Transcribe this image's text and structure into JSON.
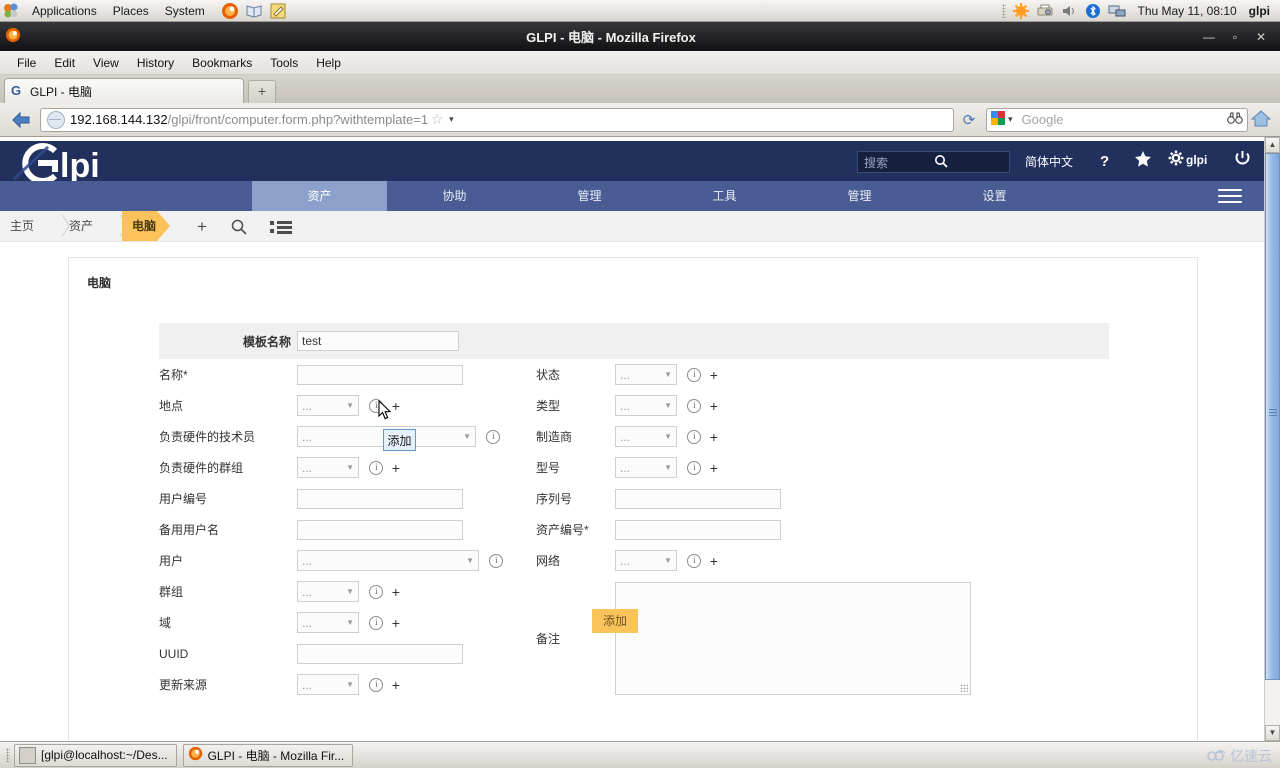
{
  "desktop": {
    "menus": [
      "Applications",
      "Places",
      "System"
    ],
    "clock": "Thu May 11, 08:10",
    "user": "glpi",
    "taskbar": [
      "[glpi@localhost:~/Des...",
      "GLPI - 电脑 - Mozilla Fir..."
    ],
    "watermark": "亿速云"
  },
  "browser": {
    "title": "GLPI - 电脑 - Mozilla Firefox",
    "minimize": "—",
    "maximize": "▫",
    "close": "✕",
    "menu": [
      "File",
      "Edit",
      "View",
      "History",
      "Bookmarks",
      "Tools",
      "Help"
    ],
    "tab_title": "GLPI - 电脑",
    "tab_favicon": "G",
    "newtab": "+",
    "url_host": "192.168.144.132",
    "url_path": "/glpi/front/computer.form.php?withtemplate=1",
    "search_placeholder": "Google"
  },
  "glpi": {
    "brand": "lpi",
    "search_placeholder": "搜索",
    "language": "简体中文",
    "help": "?",
    "user": "glpi",
    "nav": [
      {
        "label": "资产",
        "active": true
      },
      {
        "label": "协助",
        "active": false
      },
      {
        "label": "管理",
        "active": false
      },
      {
        "label": "工具",
        "active": false
      },
      {
        "label": "管理",
        "active": false
      },
      {
        "label": "设置",
        "active": false
      }
    ],
    "breadcrumb": [
      {
        "label": "主页"
      },
      {
        "label": "资产"
      },
      {
        "label": "电脑"
      }
    ],
    "page_title": "电脑",
    "template_label": "模板名称",
    "template_value": "test",
    "left_fields": [
      {
        "label": "名称*",
        "value": ""
      },
      {
        "label": "地点",
        "value": "..."
      },
      {
        "label": "负责硬件的技术员",
        "value": "..."
      },
      {
        "label": "负责硬件的群组",
        "value": "..."
      },
      {
        "label": "用户编号",
        "value": ""
      },
      {
        "label": "备用用户名",
        "value": ""
      },
      {
        "label": "用户",
        "value": "..."
      },
      {
        "label": "群组",
        "value": "..."
      },
      {
        "label": "域",
        "value": "..."
      },
      {
        "label": "UUID",
        "value": ""
      },
      {
        "label": "更新来源",
        "value": "..."
      }
    ],
    "right_fields": [
      {
        "label": "状态",
        "value": "..."
      },
      {
        "label": "类型",
        "value": "..."
      },
      {
        "label": "制造商",
        "value": "..."
      },
      {
        "label": "型号",
        "value": "..."
      },
      {
        "label": "序列号",
        "value": ""
      },
      {
        "label": "资产编号*",
        "value": ""
      },
      {
        "label": "网络",
        "value": "..."
      },
      {
        "label": "备注",
        "value": ""
      }
    ],
    "plus_label": "+",
    "info_label": "i",
    "arrow_label": "▼",
    "submit_label": "添加",
    "tooltip": "添加"
  }
}
